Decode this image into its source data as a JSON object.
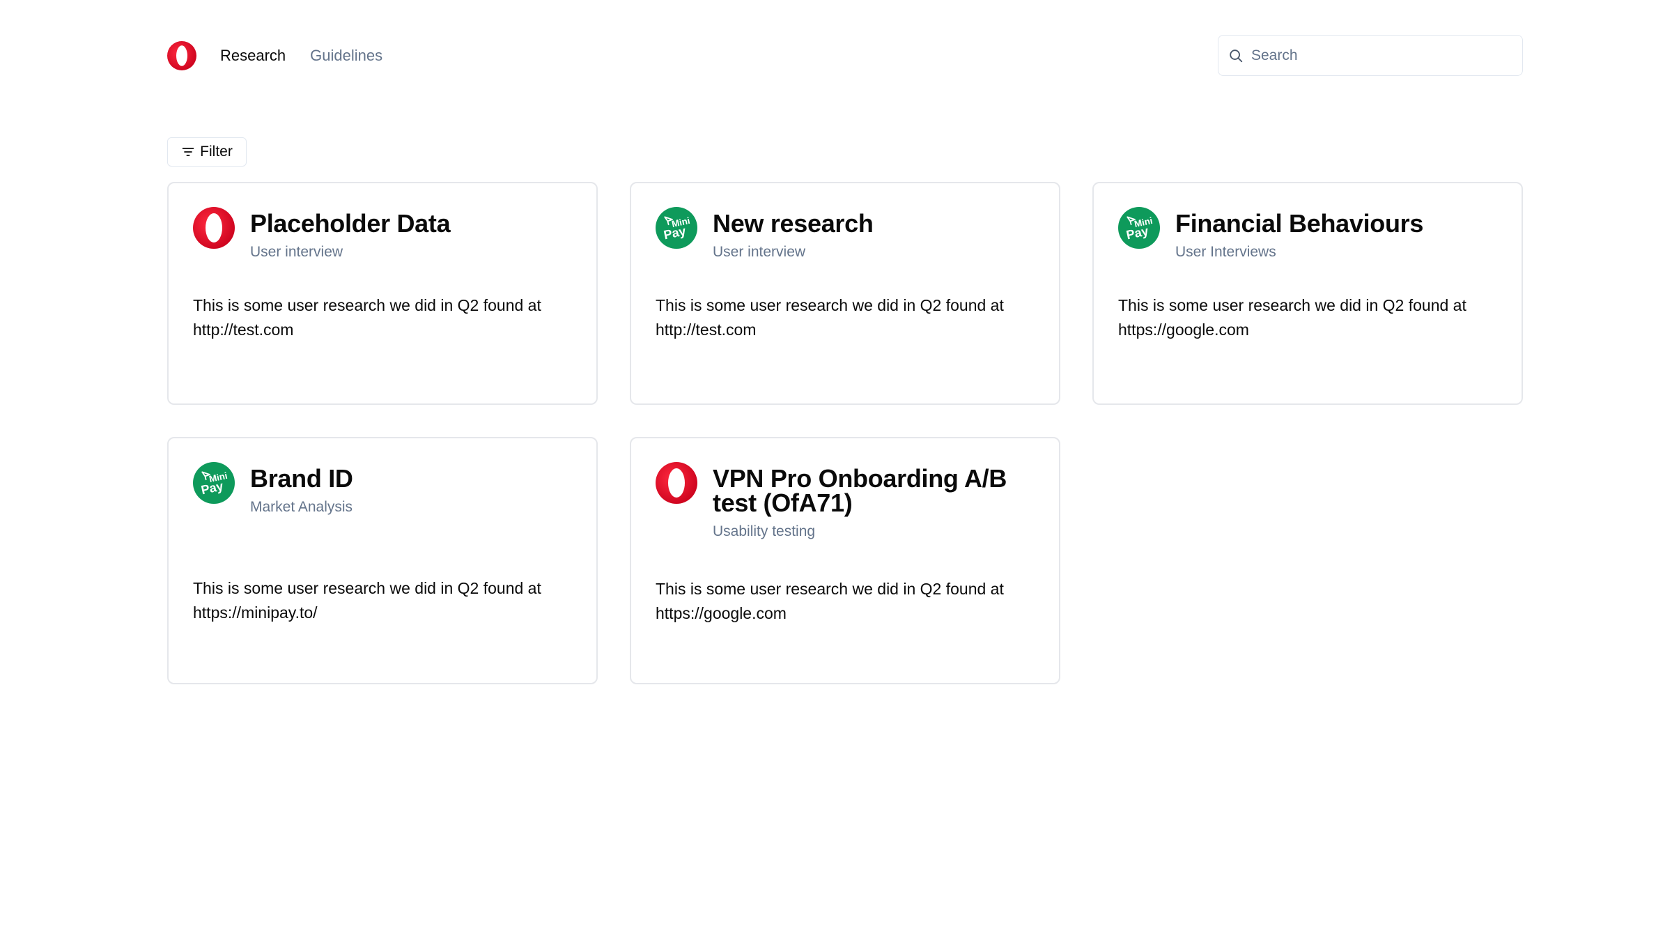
{
  "header": {
    "logo_icon": "opera-logo-icon",
    "nav": [
      {
        "label": "Research",
        "active": true
      },
      {
        "label": "Guidelines",
        "active": false
      }
    ],
    "search": {
      "placeholder": "Search",
      "value": "",
      "icon": "search-icon"
    }
  },
  "toolbar": {
    "filter_label": "Filter",
    "filter_icon": "filter-lines-icon"
  },
  "colors": {
    "opera_red": "#e0122d",
    "minipay_green": "#0e9a5b",
    "muted_text": "#64748b",
    "border": "#e5e7eb"
  },
  "cards": [
    {
      "brand": "opera",
      "title": "Placeholder Data",
      "type": "User interview",
      "description": "This is some user research we did in Q2 found at http://test.com"
    },
    {
      "brand": "minipay",
      "title": "New research",
      "type": "User interview",
      "description": "This is some user research we did in Q2 found at http://test.com"
    },
    {
      "brand": "minipay",
      "title": "Financial Behaviours",
      "type": "User Interviews",
      "description": "This is some user research we did in Q2 found at https://google.com"
    },
    {
      "brand": "minipay",
      "title": "Brand ID",
      "type": "Market Analysis",
      "description": "This is some user research we did in Q2 found at https://minipay.to/"
    },
    {
      "brand": "opera",
      "title": "VPN Pro Onboarding A/B test (OfA71)",
      "type": "Usability testing",
      "description": "This is some user research we did in Q2 found at https://google.com"
    }
  ]
}
